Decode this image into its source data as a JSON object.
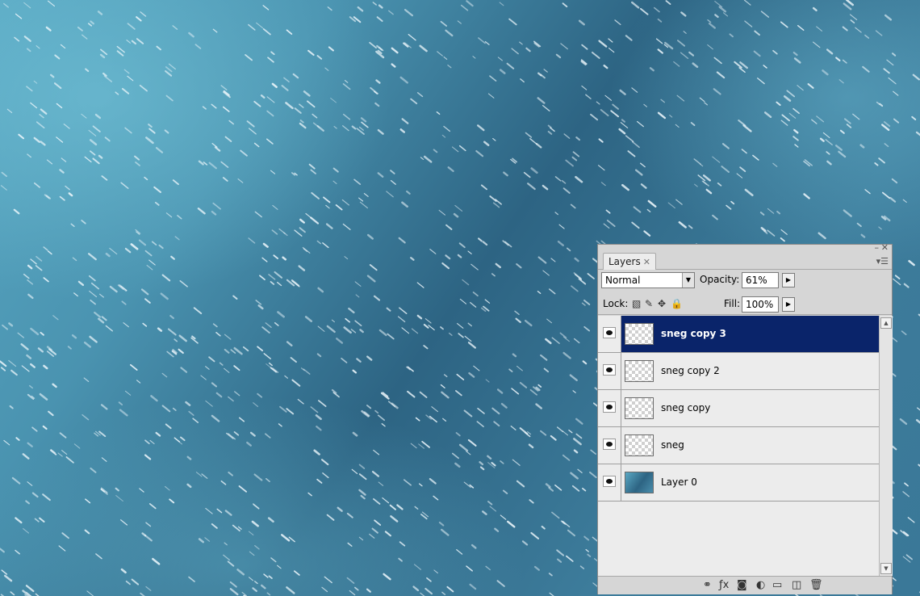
{
  "layers_panel": {
    "tab_label": "Layers",
    "blend_mode": "Normal",
    "opacity_label": "Opacity:",
    "opacity_value": "61%",
    "lock_label": "Lock:",
    "fill_label": "Fill:",
    "fill_value": "100%",
    "layers": [
      {
        "name": "sneg copy 3",
        "selected": true,
        "thumb": "transparent"
      },
      {
        "name": "sneg copy 2",
        "selected": false,
        "thumb": "transparent"
      },
      {
        "name": "sneg copy",
        "selected": false,
        "thumb": "transparent"
      },
      {
        "name": "sneg",
        "selected": false,
        "thumb": "transparent"
      },
      {
        "name": "Layer 0",
        "selected": false,
        "thumb": "image"
      }
    ],
    "bottom_icons": [
      "link-icon",
      "fx-icon",
      "mask-icon",
      "adjustment-icon",
      "folder-icon",
      "new-layer-icon",
      "trash-icon"
    ],
    "bottom_glyphs": [
      "⚭",
      "ƒx",
      "◙",
      "◐",
      "▭",
      "◫",
      "🗑"
    ],
    "colors": {
      "selected_row": "#0a246a",
      "panel_bg": "#d6d6d6",
      "list_bg": "#ececec"
    }
  }
}
